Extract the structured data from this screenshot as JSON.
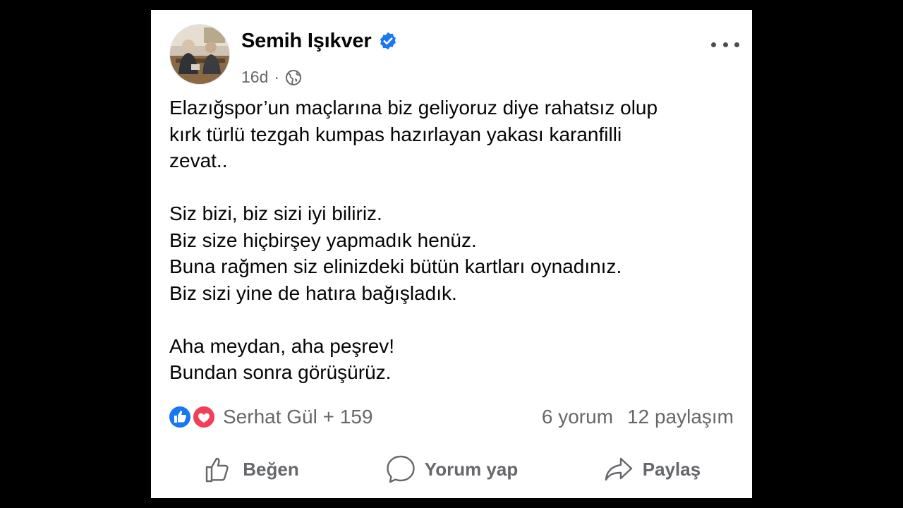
{
  "post": {
    "author": "Semih Işıkver",
    "time": "16d",
    "separator": "·",
    "verified": true,
    "paragraphs": [
      [
        "Elazığspor’un maçlarına biz geliyoruz diye rahatsız olup",
        "kırk türlü tezgah kumpas hazırlayan yakası karanfilli",
        "zevat.."
      ],
      [
        "Siz bizi, biz sizi iyi biliriz.",
        "Biz size hiçbirşey yapmadık henüz.",
        "Buna rağmen siz elinizdeki bütün kartları oynadınız.",
        "Biz sizi yine de hatıra bağışladık."
      ],
      [
        "Aha meydan, aha peşrev!",
        "Bundan sonra görüşürüz."
      ]
    ]
  },
  "reactions": {
    "summary": "Serhat Gül + 159",
    "icons": [
      "like-icon",
      "love-icon"
    ],
    "comments": "6 yorum",
    "shares": "12 paylaşım"
  },
  "actions": {
    "like": "Beğen",
    "comment": "Yorum yap",
    "share": "Paylaş"
  },
  "colors": {
    "verified": "#1877f2",
    "like": "#1877f2",
    "love": "#f33e58",
    "secondary_text": "#65676b"
  }
}
